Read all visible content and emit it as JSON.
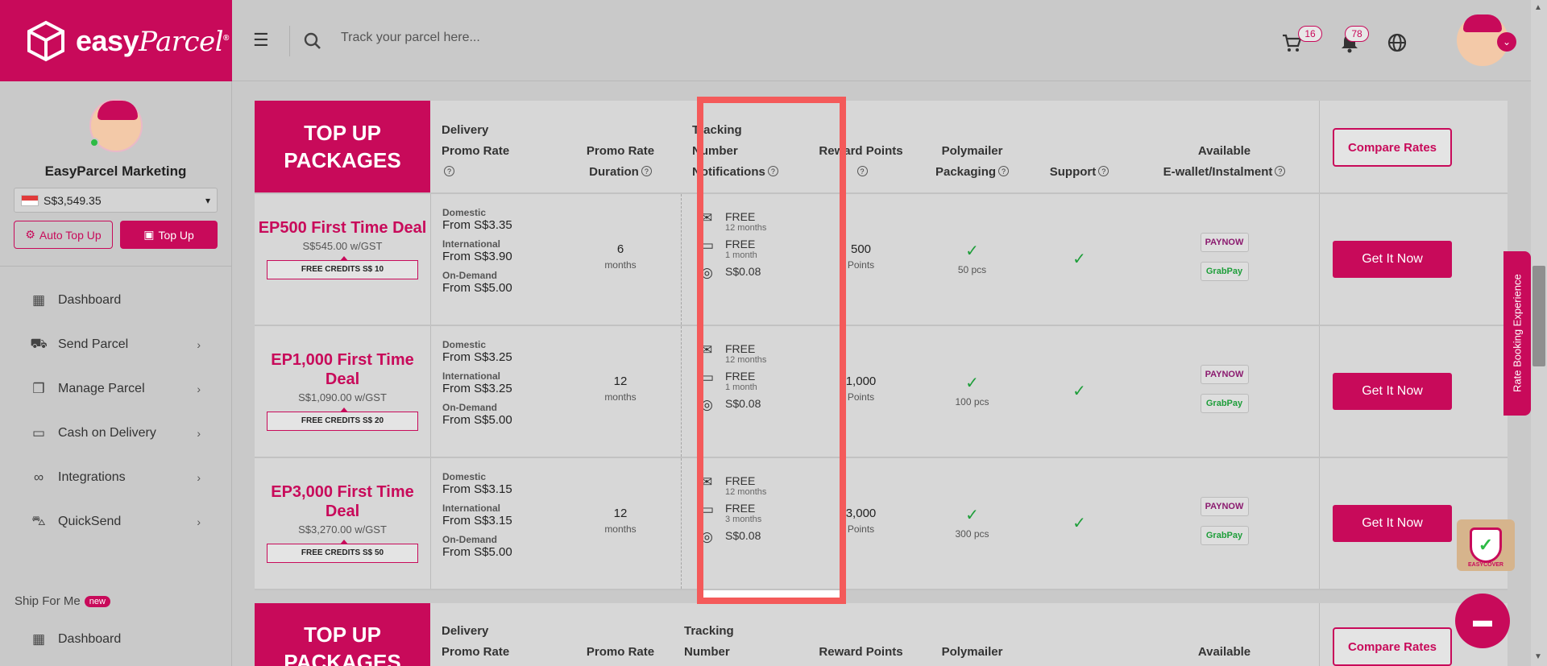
{
  "brand": {
    "name": "easy",
    "name_script": "Parcel",
    "mark": "®"
  },
  "header": {
    "search_placeholder": "Track your parcel here...",
    "cart_count": "16",
    "notif_count": "78"
  },
  "sidebar": {
    "profile_name": "EasyParcel Marketing",
    "balance": "S$3,549.35",
    "auto_topup_label": "Auto Top Up",
    "topup_label": "Top Up",
    "items": [
      {
        "label": "Dashboard",
        "icon": "dashboard-icon"
      },
      {
        "label": "Send Parcel",
        "icon": "truck-icon"
      },
      {
        "label": "Manage Parcel",
        "icon": "boxes-icon"
      },
      {
        "label": "Cash on Delivery",
        "icon": "cash-icon"
      },
      {
        "label": "Integrations",
        "icon": "link-icon"
      },
      {
        "label": "QuickSend",
        "icon": "cart-plus-icon"
      }
    ],
    "ship_for_me_label": "Ship For Me",
    "new_badge": "new",
    "ship_dashboard_label": "Dashboard"
  },
  "table": {
    "title_line1": "TOP UP",
    "title_line2": "PACKAGES",
    "headers": {
      "rate_1": "Delivery",
      "rate_2": "Promo Rate",
      "duration_1": "Promo Rate",
      "duration_2": "Duration",
      "track_1": "Tracking",
      "track_2": "Number",
      "track_3": "Notifications",
      "reward": "Reward Points",
      "poly_1": "Polymailer",
      "poly_2": "Packaging",
      "support": "Support",
      "wallet_1": "Available",
      "wallet_2": "E-wallet/Instalment"
    },
    "compare_label": "Compare Rates",
    "get_label": "Get It Now",
    "rate_labels": {
      "domestic": "Domestic",
      "international": "International",
      "ondemand": "On-Demand"
    },
    "wallets": {
      "paynow": "PAYNOW",
      "grabpay": "GrabPay"
    },
    "rows": [
      {
        "name": "EP500 First Time Deal",
        "price": "S$545.00 w/GST",
        "credits": "FREE CREDITS S$ 10",
        "domestic": "From S$3.35",
        "international": "From S$3.90",
        "ondemand": "From S$5.00",
        "duration": "6",
        "duration_unit": "months",
        "email": "FREE",
        "email_sub": "12 months",
        "sms": "FREE",
        "sms_sub": "1 month",
        "whatsapp": "S$0.08",
        "points": "500",
        "points_unit": "Points",
        "poly": "50 pcs"
      },
      {
        "name": "EP1,000 First Time Deal",
        "price": "S$1,090.00 w/GST",
        "credits": "FREE CREDITS S$ 20",
        "domestic": "From S$3.25",
        "international": "From S$3.25",
        "ondemand": "From S$5.00",
        "duration": "12",
        "duration_unit": "months",
        "email": "FREE",
        "email_sub": "12 months",
        "sms": "FREE",
        "sms_sub": "1 month",
        "whatsapp": "S$0.08",
        "points": "1,000",
        "points_unit": "Points",
        "poly": "100 pcs"
      },
      {
        "name": "EP3,000 First Time Deal",
        "price": "S$3,270.00 w/GST",
        "credits": "FREE CREDITS S$ 50",
        "domestic": "From S$3.15",
        "international": "From S$3.15",
        "ondemand": "From S$5.00",
        "duration": "12",
        "duration_unit": "months",
        "email": "FREE",
        "email_sub": "12 months",
        "sms": "FREE",
        "sms_sub": "3 months",
        "whatsapp": "S$0.08",
        "points": "3,000",
        "points_unit": "Points",
        "poly": "300 pcs"
      }
    ]
  },
  "widgets": {
    "rate_experience": "Rate Booking Experience",
    "easycover": "EASYCOVER"
  },
  "colors": {
    "accent": "#c80a5a",
    "highlight": "#f45a5a",
    "check": "#1e9e3a"
  }
}
